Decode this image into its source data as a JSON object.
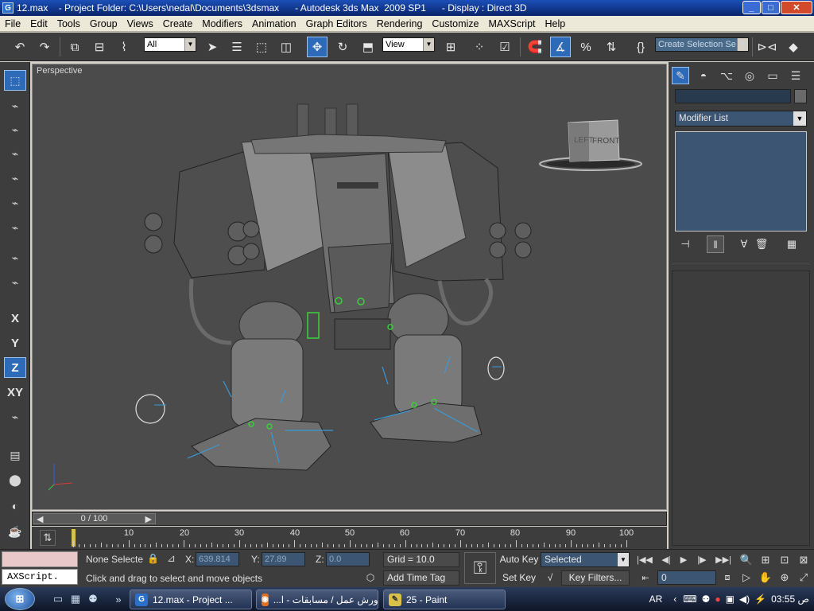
{
  "window": {
    "title": "12.max    - Project Folder: C:\\Users\\nedal\\Documents\\3dsmax      - Autodesk 3ds Max  2009 SP1      - Display : Direct 3D",
    "buttons": [
      "_",
      "□",
      "✕"
    ]
  },
  "menu": [
    "File",
    "Edit",
    "Tools",
    "Group",
    "Views",
    "Create",
    "Modifiers",
    "Animation",
    "Graph Editors",
    "Rendering",
    "Customize",
    "MAXScript",
    "Help"
  ],
  "toolbar": {
    "selection_filter": "All",
    "ref_coord": "View",
    "selection_set_placeholder": "Create Selection Se"
  },
  "left_axis": {
    "x": "X",
    "y": "Y",
    "z": "Z",
    "xy": "XY"
  },
  "viewport": {
    "label": "Perspective",
    "viewcube_left": "LEFT",
    "viewcube_front": "FRONT"
  },
  "command_panel": {
    "modifier_list": "Modifier List"
  },
  "timeline": {
    "slider": "0 / 100",
    "ticks": [
      "10",
      "20",
      "30",
      "40",
      "50",
      "60",
      "70",
      "80",
      "90",
      "100"
    ]
  },
  "status": {
    "maxscript": "AXScript.",
    "selection": "None Selecte",
    "x_label": "X:",
    "x_value": "639.814",
    "y_label": "Y:",
    "y_value": "27.89",
    "z_label": "Z:",
    "z_value": "0.0",
    "grid": "Grid = 10.0",
    "prompt": "Click and drag to select and move objects",
    "add_time_tag": "Add Time Tag",
    "auto_key": "Auto Key",
    "set_key": "Set Key",
    "key_mode": "Selected",
    "key_filters": "Key Filters...",
    "frame": "0"
  },
  "taskbar": {
    "tasks": [
      {
        "label": "12.max    - Project ..."
      },
      {
        "label": "...ورش عمل / مسابقات - ا"
      },
      {
        "label": "25 - Paint"
      }
    ],
    "lang": "AR",
    "clock": "03:55 ص"
  }
}
